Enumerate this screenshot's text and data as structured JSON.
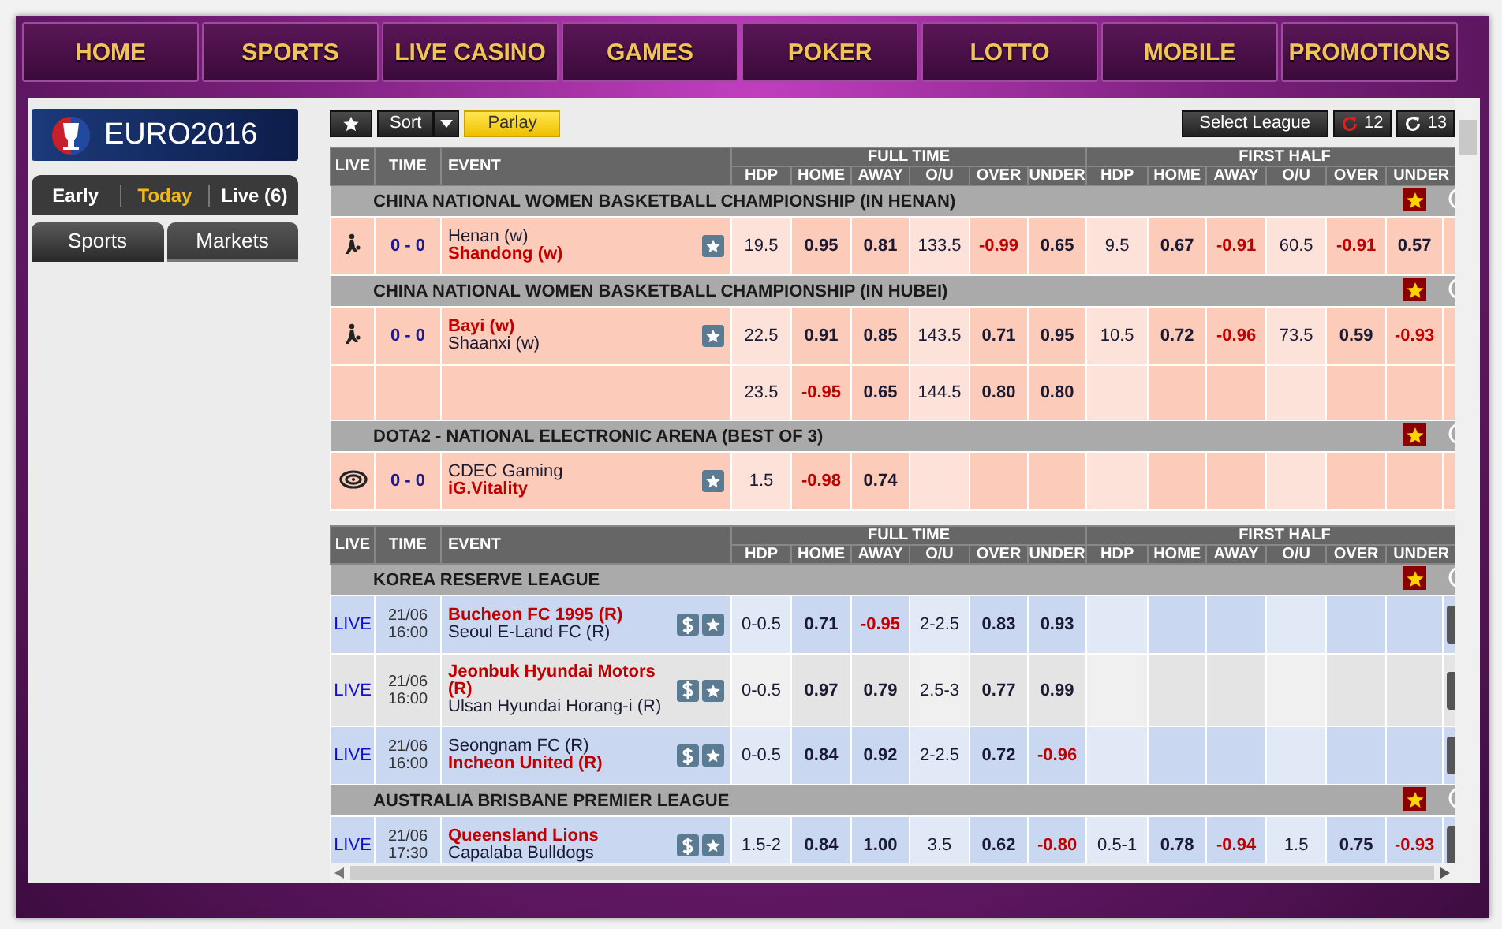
{
  "nav": [
    {
      "label": "HOME"
    },
    {
      "label": "SPORTS"
    },
    {
      "label": "LIVE CASINO"
    },
    {
      "label": "GAMES"
    },
    {
      "label": "POKER"
    },
    {
      "label": "LOTTO"
    },
    {
      "label": "MOBILE"
    },
    {
      "label": "PROMOTIONS"
    }
  ],
  "sidebar": {
    "logo": "EURO2016",
    "period_tabs": [
      {
        "label": "Early",
        "selected": false
      },
      {
        "label": "Today",
        "selected": true
      },
      {
        "label": "Live (6)",
        "selected": false
      }
    ],
    "view_tabs": [
      {
        "label": "Sports",
        "selected": true
      },
      {
        "label": "Markets",
        "selected": false
      }
    ]
  },
  "toolbar": {
    "sort": "Sort",
    "parlay": "Parlay",
    "select_league": "Select League",
    "refresh_counts": [
      {
        "label": "12",
        "kind": "red"
      },
      {
        "label": "13",
        "kind": "dark"
      }
    ]
  },
  "tables": [
    {
      "header": {
        "live": "LIVE",
        "time": "TIME",
        "event": "EVENT",
        "groups": [
          "FULL TIME",
          "FIRST HALF"
        ],
        "columns": [
          "HDP",
          "HOME",
          "AWAY",
          "O/U",
          "OVER",
          "UNDER",
          "HDP",
          "HOME",
          "AWAY",
          "O/U",
          "OVER",
          "UNDER"
        ]
      },
      "leagues": [
        {
          "name": "CHINA NATIONAL WOMEN BASKETBALL CHAMPIONSHIP (IN HENAN)",
          "matches": [
            {
              "color": "#fccbb9",
              "kind": "basketball",
              "score": "0 - 0",
              "cash_out": false,
              "teams": [
                {
                  "name": "Henan (w)",
                  "red": false
                },
                {
                  "name": "Shandong (w)",
                  "red": true
                }
              ],
              "rows": [
                [
                  {
                    "t": "19.5",
                    "red": false
                  },
                  {
                    "t": "0.95",
                    "red": false
                  },
                  {
                    "t": "0.81",
                    "red": false
                  },
                  {
                    "t": "133.5",
                    "red": false
                  },
                  {
                    "t": "-0.99",
                    "red": true
                  },
                  {
                    "t": "0.65",
                    "red": false
                  },
                  {
                    "t": "9.5",
                    "red": false
                  },
                  {
                    "t": "0.67",
                    "red": false
                  },
                  {
                    "t": "-0.91",
                    "red": true
                  },
                  {
                    "t": "60.5",
                    "red": false
                  },
                  {
                    "t": "-0.91",
                    "red": true
                  },
                  {
                    "t": "0.57",
                    "red": false
                  }
                ]
              ]
            }
          ]
        },
        {
          "name": "CHINA NATIONAL WOMEN BASKETBALL CHAMPIONSHIP (IN HUBEI)",
          "matches": [
            {
              "color": "#fccbb9",
              "kind": "basketball",
              "score": "0 - 0",
              "cash_out": false,
              "teams": [
                {
                  "name": "Bayi (w)",
                  "red": true
                },
                {
                  "name": "Shaanxi (w)",
                  "red": false
                }
              ],
              "rows": [
                [
                  {
                    "t": "22.5",
                    "red": false
                  },
                  {
                    "t": "0.91",
                    "red": false
                  },
                  {
                    "t": "0.85",
                    "red": false
                  },
                  {
                    "t": "143.5",
                    "red": false
                  },
                  {
                    "t": "0.71",
                    "red": false
                  },
                  {
                    "t": "0.95",
                    "red": false
                  },
                  {
                    "t": "10.5",
                    "red": false
                  },
                  {
                    "t": "0.72",
                    "red": false
                  },
                  {
                    "t": "-0.96",
                    "red": true
                  },
                  {
                    "t": "73.5",
                    "red": false
                  },
                  {
                    "t": "0.59",
                    "red": false
                  },
                  {
                    "t": "-0.93",
                    "red": true
                  }
                ],
                [
                  {
                    "t": "23.5",
                    "red": false
                  },
                  {
                    "t": "-0.95",
                    "red": true
                  },
                  {
                    "t": "0.65",
                    "red": false
                  },
                  {
                    "t": "144.5",
                    "red": false
                  },
                  {
                    "t": "0.80",
                    "red": false
                  },
                  {
                    "t": "0.80",
                    "red": false
                  },
                  null,
                  null,
                  null,
                  null,
                  null,
                  null
                ]
              ]
            }
          ]
        },
        {
          "name": "DOTA2 - NATIONAL ELECTRONIC ARENA (BEST OF 3)",
          "matches": [
            {
              "color": "#fccbb9",
              "kind": "esports",
              "score": "0 - 0",
              "cash_out": false,
              "teams": [
                {
                  "name": "CDEC Gaming",
                  "red": false
                },
                {
                  "name": "iG.Vitality",
                  "red": true
                }
              ],
              "rows": [
                [
                  {
                    "t": "1.5",
                    "red": false
                  },
                  {
                    "t": "-0.98",
                    "red": true
                  },
                  {
                    "t": "0.74",
                    "red": false
                  },
                  null,
                  null,
                  null,
                  null,
                  null,
                  null,
                  null,
                  null,
                  null
                ]
              ]
            }
          ]
        }
      ]
    },
    {
      "header": {
        "live": "LIVE",
        "time": "TIME",
        "event": "EVENT",
        "groups": [
          "FULL TIME",
          "FIRST HALF"
        ],
        "columns": [
          "HDP",
          "HOME",
          "AWAY",
          "O/U",
          "OVER",
          "UNDER",
          "HDP",
          "HOME",
          "AWAY",
          "O/U",
          "OVER",
          "UNDER"
        ]
      },
      "leagues": [
        {
          "name": "KOREA RESERVE LEAGUE",
          "matches": [
            {
              "color": "#c9d7f1",
              "kind": "live",
              "live": "LIVE",
              "time": [
                "21/06",
                "16:00"
              ],
              "cash_out": true,
              "teams": [
                {
                  "name": "Bucheon FC 1995 (R)",
                  "red": true
                },
                {
                  "name": "Seoul E-Land FC (R)",
                  "red": false
                }
              ],
              "rows": [
                [
                  {
                    "t": "0-0.5",
                    "red": false
                  },
                  {
                    "t": "0.71",
                    "red": false
                  },
                  {
                    "t": "-0.95",
                    "red": true
                  },
                  {
                    "t": "2-2.5",
                    "red": false
                  },
                  {
                    "t": "0.83",
                    "red": false
                  },
                  {
                    "t": "0.93",
                    "red": false
                  },
                  null,
                  null,
                  null,
                  null,
                  null,
                  null
                ]
              ]
            },
            {
              "color": "#e4e4e4",
              "kind": "live",
              "live": "LIVE",
              "time": [
                "21/06",
                "16:00"
              ],
              "cash_out": true,
              "teams": [
                {
                  "name": "Jeonbuk Hyundai Motors (R)",
                  "red": true
                },
                {
                  "name": "Ulsan Hyundai Horang-i (R)",
                  "red": false
                }
              ],
              "rows": [
                [
                  {
                    "t": "0-0.5",
                    "red": false
                  },
                  {
                    "t": "0.97",
                    "red": false
                  },
                  {
                    "t": "0.79",
                    "red": false
                  },
                  {
                    "t": "2.5-3",
                    "red": false
                  },
                  {
                    "t": "0.77",
                    "red": false
                  },
                  {
                    "t": "0.99",
                    "red": false
                  },
                  null,
                  null,
                  null,
                  null,
                  null,
                  null
                ]
              ]
            },
            {
              "color": "#c9d7f1",
              "kind": "live",
              "live": "LIVE",
              "time": [
                "21/06",
                "16:00"
              ],
              "cash_out": true,
              "teams": [
                {
                  "name": "Seongnam FC (R)",
                  "red": false
                },
                {
                  "name": "Incheon United (R)",
                  "red": true
                }
              ],
              "rows": [
                [
                  {
                    "t": "0-0.5",
                    "red": false
                  },
                  {
                    "t": "0.84",
                    "red": false
                  },
                  {
                    "t": "0.92",
                    "red": false
                  },
                  {
                    "t": "2-2.5",
                    "red": false
                  },
                  {
                    "t": "0.72",
                    "red": false
                  },
                  {
                    "t": "-0.96",
                    "red": true
                  },
                  null,
                  null,
                  null,
                  null,
                  null,
                  null
                ]
              ]
            }
          ]
        },
        {
          "name": "AUSTRALIA BRISBANE PREMIER LEAGUE",
          "matches": [
            {
              "color": "#c9d7f1",
              "kind": "live",
              "live": "LIVE",
              "time": [
                "21/06",
                "17:30"
              ],
              "cash_out": true,
              "teams": [
                {
                  "name": "Queensland Lions",
                  "red": true
                },
                {
                  "name": "Capalaba Bulldogs",
                  "red": false
                }
              ],
              "rows": [
                [
                  {
                    "t": "1.5-2",
                    "red": false
                  },
                  {
                    "t": "0.84",
                    "red": false
                  },
                  {
                    "t": "1.00",
                    "red": false
                  },
                  {
                    "t": "3.5",
                    "red": false
                  },
                  {
                    "t": "0.62",
                    "red": false
                  },
                  {
                    "t": "-0.80",
                    "red": true
                  },
                  {
                    "t": "0.5-1",
                    "red": false
                  },
                  {
                    "t": "0.78",
                    "red": false
                  },
                  {
                    "t": "-0.94",
                    "red": true
                  },
                  {
                    "t": "1.5",
                    "red": false
                  },
                  {
                    "t": "0.75",
                    "red": false
                  },
                  {
                    "t": "-0.93",
                    "red": true
                  }
                ]
              ]
            }
          ]
        }
      ]
    }
  ]
}
